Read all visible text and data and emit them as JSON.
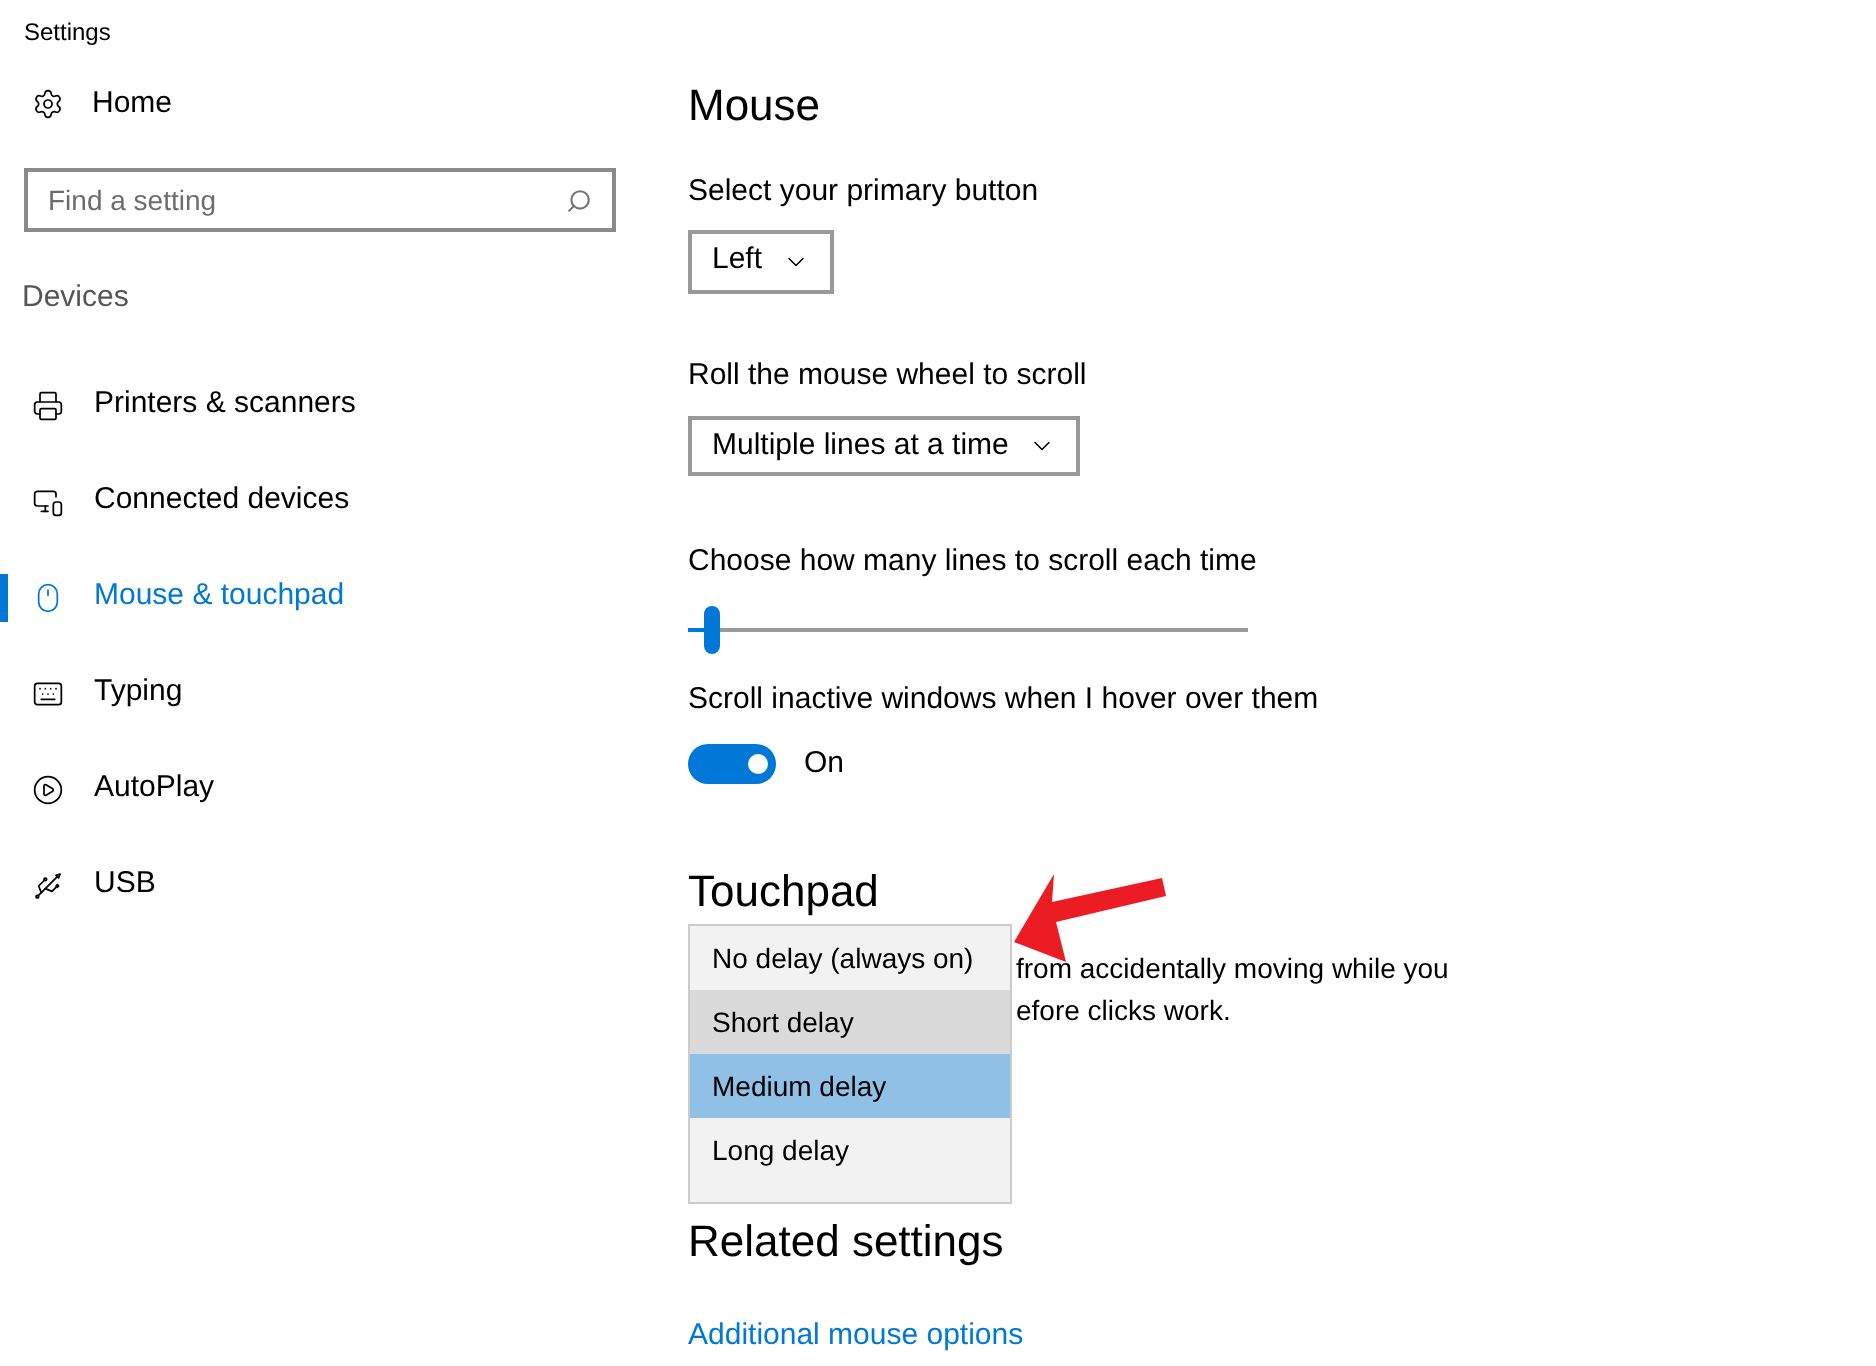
{
  "window": {
    "title": "Settings"
  },
  "sidebar": {
    "home": "Home",
    "search": {
      "placeholder": "Find a setting"
    },
    "section": "Devices",
    "items": [
      {
        "label": "Printers & scanners",
        "selected": false
      },
      {
        "label": "Connected devices",
        "selected": false
      },
      {
        "label": "Mouse & touchpad",
        "selected": true
      },
      {
        "label": "Typing",
        "selected": false
      },
      {
        "label": "AutoPlay",
        "selected": false
      },
      {
        "label": "USB",
        "selected": false
      }
    ]
  },
  "mouse": {
    "heading": "Mouse",
    "primary_button": {
      "label": "Select your primary button",
      "value": "Left"
    },
    "wheel": {
      "label": "Roll the mouse wheel to scroll",
      "value": "Multiple lines at a time"
    },
    "lines": {
      "label": "Choose how many lines to scroll each time",
      "level": 0.03
    },
    "inactive": {
      "label": "Scroll inactive windows when I hover over them",
      "on": true,
      "state": "On"
    }
  },
  "touchpad": {
    "heading": "Touchpad",
    "description_lines": [
      "from accidentally moving while you",
      "efore clicks work."
    ],
    "delay_menu": [
      {
        "label": "No delay (always on)",
        "hovered": false,
        "selected": false
      },
      {
        "label": "Short delay",
        "hovered": true,
        "selected": false
      },
      {
        "label": "Medium delay",
        "hovered": false,
        "selected": true
      },
      {
        "label": "Long delay",
        "hovered": false,
        "selected": false
      }
    ]
  },
  "related": {
    "heading": "Related settings",
    "links": [
      "Additional mouse options"
    ]
  }
}
